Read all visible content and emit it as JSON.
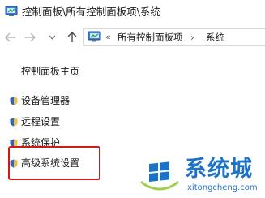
{
  "window": {
    "title": "控制面板\\所有控制面板项\\系统",
    "icon": "control-panel-icon"
  },
  "navigation": {
    "back_icon": "back-arrow-icon",
    "forward_icon": "forward-arrow-icon",
    "recent_icon": "chevron-down-icon",
    "up_icon": "up-arrow-icon",
    "address": {
      "icon": "control-panel-icon",
      "overflow": "«",
      "crumbs": [
        "所有控制面板项",
        "系统"
      ],
      "separator": "›"
    }
  },
  "left_pane": {
    "home": "控制面板主页",
    "links": [
      {
        "label": "设备管理器",
        "icon": "shield-icon"
      },
      {
        "label": "远程设置",
        "icon": "shield-icon"
      },
      {
        "label": "系统保护",
        "icon": "shield-icon"
      },
      {
        "label": "高级系统设置",
        "icon": "shield-icon",
        "highlighted": true
      }
    ]
  },
  "watermark": {
    "title": "系统城",
    "url": "xitongcheng.com",
    "logo": "windows-logo-icon"
  },
  "colors": {
    "highlight": "#d21919",
    "watermark": "#1c72c6",
    "shield_blue": "#2a66c8",
    "shield_yellow": "#f2c037"
  }
}
